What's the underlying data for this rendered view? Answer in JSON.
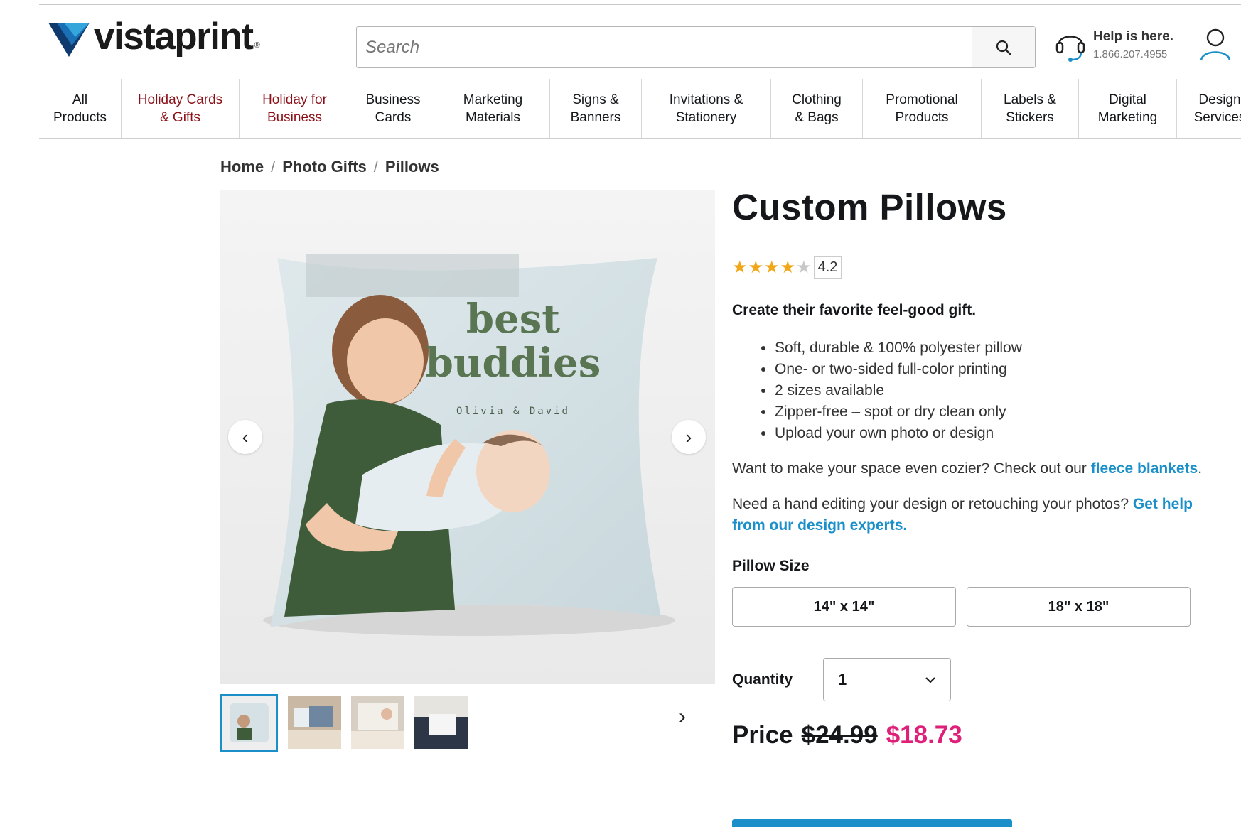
{
  "header": {
    "logo_text": "vistaprint",
    "logo_reg": "®",
    "search_placeholder": "Search",
    "help_title": "Help is here.",
    "help_phone": "1.866.207.4955"
  },
  "nav": [
    {
      "label": "All Products",
      "line1": "All",
      "line2": "Products",
      "red": false
    },
    {
      "label": "Holiday Cards & Gifts",
      "line1": "Holiday Cards",
      "line2": "& Gifts",
      "red": true
    },
    {
      "label": "Holiday for Business",
      "line1": "Holiday for",
      "line2": "Business",
      "red": true
    },
    {
      "label": "Business Cards",
      "line1": "Business",
      "line2": "Cards",
      "red": false
    },
    {
      "label": "Marketing Materials",
      "line1": "Marketing",
      "line2": "Materials",
      "red": false
    },
    {
      "label": "Signs & Banners",
      "line1": "Signs &",
      "line2": "Banners",
      "red": false
    },
    {
      "label": "Invitations & Stationery",
      "line1": "Invitations &",
      "line2": "Stationery",
      "red": false
    },
    {
      "label": "Clothing & Bags",
      "line1": "Clothing",
      "line2": "& Bags",
      "red": false
    },
    {
      "label": "Promotional Products",
      "line1": "Promotional",
      "line2": "Products",
      "red": false
    },
    {
      "label": "Labels & Stickers",
      "line1": "Labels &",
      "line2": "Stickers",
      "red": false
    },
    {
      "label": "Digital Marketing",
      "line1": "Digital",
      "line2": "Marketing",
      "red": false
    },
    {
      "label": "Design Services",
      "line1": "Design",
      "line2": "Services",
      "red": false
    }
  ],
  "breadcrumb": {
    "home": "Home",
    "sep": "/",
    "category": "Photo Gifts",
    "current": "Pillows"
  },
  "gallery": {
    "pillow_text_line1": "best",
    "pillow_text_line2": "buddies",
    "pillow_names": "Olivia & David",
    "prev_arrow": "‹",
    "next_arrow": "›",
    "thumb_next": "›"
  },
  "product": {
    "title": "Custom Pillows",
    "rating": "4.2",
    "stars_full": "★★★★",
    "stars_empty": "★",
    "tagline": "Create their favorite feel-good gift.",
    "bullets": [
      "Soft, durable & 100% polyester pillow",
      "One- or two-sided full-color printing",
      "2 sizes available",
      "Zipper-free – spot or dry clean only",
      "Upload your own photo or design"
    ],
    "cozier_text": "Want to make your space even cozier? Check out our",
    "cozier_link": "fleece blankets",
    "cozier_end": ".",
    "help_text": "Need a hand editing your design or retouching your photos?",
    "help_link": "Get help from our design experts.",
    "size_label": "Pillow Size",
    "sizes": [
      "14\" x 14\"",
      "18\" x 18\""
    ],
    "qty_label": "Quantity",
    "qty_value": "1",
    "price_label": "Price",
    "price_old": "$24.99",
    "price_new": "$18.73"
  },
  "colors": {
    "brand_blue": "#1a8fc9",
    "sale_pink": "#de2078",
    "nav_red": "#8b1018"
  }
}
